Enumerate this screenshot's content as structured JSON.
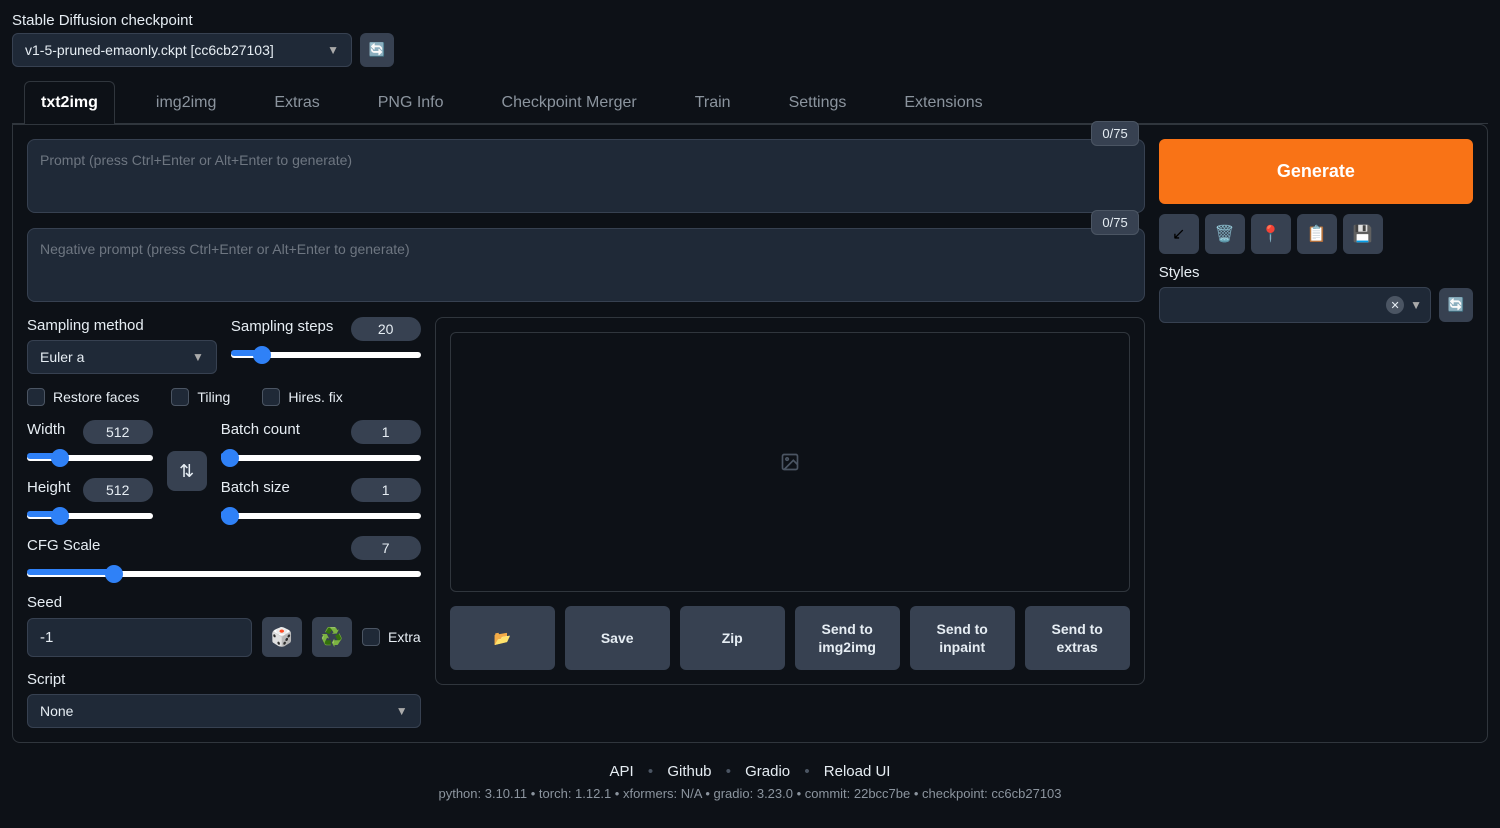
{
  "checkpoint": {
    "label": "Stable Diffusion checkpoint",
    "value": "v1-5-pruned-emaonly.ckpt [cc6cb27103]"
  },
  "tabs": [
    "txt2img",
    "img2img",
    "Extras",
    "PNG Info",
    "Checkpoint Merger",
    "Train",
    "Settings",
    "Extensions"
  ],
  "prompt": {
    "placeholder": "Prompt (press Ctrl+Enter or Alt+Enter to generate)",
    "tokens": "0/75"
  },
  "neg_prompt": {
    "placeholder": "Negative prompt (press Ctrl+Enter or Alt+Enter to generate)",
    "tokens": "0/75"
  },
  "sampling": {
    "method_label": "Sampling method",
    "method_value": "Euler a",
    "steps_label": "Sampling steps",
    "steps_value": "20"
  },
  "checks": {
    "restore": "Restore faces",
    "tiling": "Tiling",
    "hires": "Hires. fix"
  },
  "dims": {
    "width_label": "Width",
    "width_value": "512",
    "height_label": "Height",
    "height_value": "512"
  },
  "batch": {
    "count_label": "Batch count",
    "count_value": "1",
    "size_label": "Batch size",
    "size_value": "1"
  },
  "cfg": {
    "label": "CFG Scale",
    "value": "7"
  },
  "seed": {
    "label": "Seed",
    "value": "-1",
    "extra_label": "Extra"
  },
  "script": {
    "label": "Script",
    "value": "None"
  },
  "generate_label": "Generate",
  "styles_label": "Styles",
  "actions": {
    "save": "Save",
    "zip": "Zip",
    "img2img": "Send to img2img",
    "inpaint": "Send to inpaint",
    "extras": "Send to extras"
  },
  "footer": {
    "links": [
      "API",
      "Github",
      "Gradio",
      "Reload UI"
    ],
    "info": "python: 3.10.11  •  torch: 1.12.1  •  xformers: N/A  •  gradio: 3.23.0  •  commit: 22bcc7be  •  checkpoint: cc6cb27103"
  }
}
